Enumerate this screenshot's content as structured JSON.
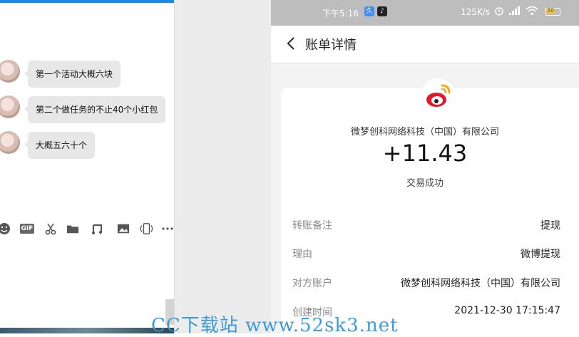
{
  "chat": {
    "messages": [
      {
        "text": "第一个活动大概六块"
      },
      {
        "text": "第二个做任务的不止40个小红包"
      },
      {
        "text": "大概五六十个"
      }
    ],
    "toolbar_icons": [
      "emoji-icon",
      "gif-icon",
      "scissors-icon",
      "folder-icon",
      "music-icon",
      "image-icon",
      "shake-icon",
      "more-icon"
    ],
    "gif_label": "GIF"
  },
  "phone": {
    "status_bar": {
      "time": "下午5:16",
      "app1": "久",
      "app2": "♪",
      "speed": "125K/s",
      "battery": "30"
    },
    "nav": {
      "title": "账单详情"
    },
    "bill": {
      "merchant": "微梦创科网络科技（中国）有限公司",
      "amount": "+11.43",
      "status": "交易成功",
      "rows": [
        {
          "key": "转账备注",
          "value": "提现"
        },
        {
          "key": "理由",
          "value": "微博提现"
        },
        {
          "key": "对方账户",
          "value": "微梦创科网络科技（中国）有限公司"
        },
        {
          "key": "创建时间",
          "value": "2021-12-30 17:15:47"
        }
      ]
    },
    "colors": {
      "accent_blue": "#1e88e5",
      "weibo_red": "#e6162d",
      "weibo_orange": "#f5a623"
    }
  },
  "watermark": "CC下载站 www.52sk3.net"
}
